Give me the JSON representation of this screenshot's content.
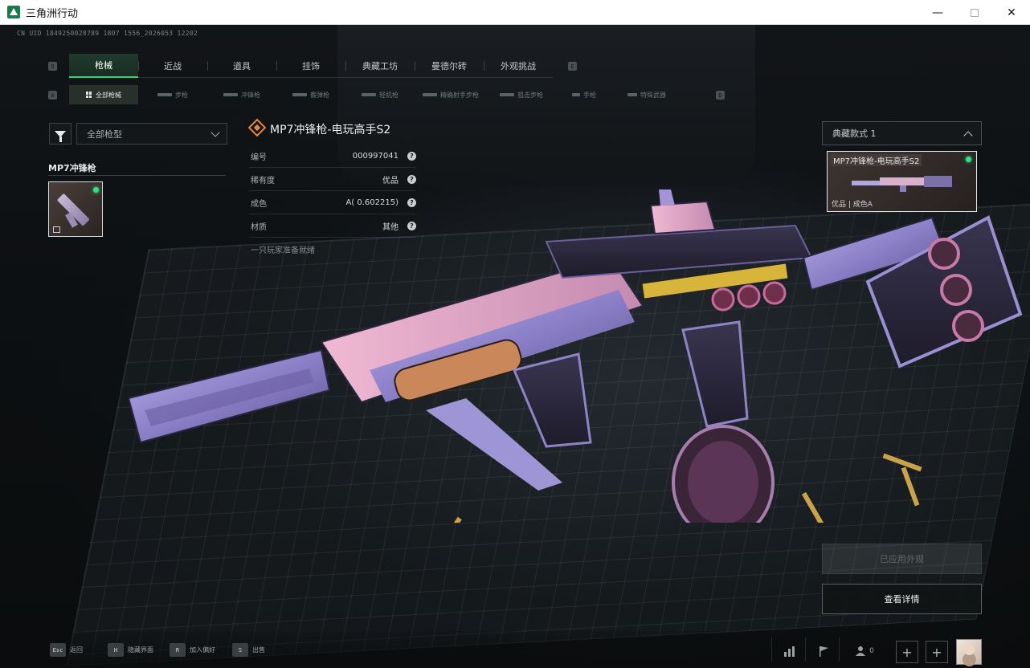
{
  "window": {
    "title": "三角洲行动"
  },
  "uid_text": "CN UID 1849250028789 1807 1556_2026053 12202",
  "key_hints": {
    "q": "Q",
    "e": "E",
    "a": "A",
    "d": "D"
  },
  "main_tabs": [
    {
      "label": "枪械",
      "active": true
    },
    {
      "label": "近战",
      "active": false
    },
    {
      "label": "道具",
      "active": false
    },
    {
      "label": "挂饰",
      "active": false
    },
    {
      "label": "典藏工坊",
      "active": false
    },
    {
      "label": "曼德尔砖",
      "active": false
    },
    {
      "label": "外观挑战",
      "active": false
    }
  ],
  "sub_tabs": [
    {
      "label": "全部枪械",
      "active": true
    },
    {
      "label": "步枪",
      "active": false
    },
    {
      "label": "冲锋枪",
      "active": false
    },
    {
      "label": "霰弹枪",
      "active": false
    },
    {
      "label": "轻机枪",
      "active": false
    },
    {
      "label": "精确射手步枪",
      "active": false
    },
    {
      "label": "狙击步枪",
      "active": false
    },
    {
      "label": "手枪",
      "active": false
    },
    {
      "label": "特殊武器",
      "active": false
    }
  ],
  "filter": {
    "dropdown_value": "全部枪型"
  },
  "weapon_group": {
    "title": "MP7冲锋枪"
  },
  "item": {
    "name": "MP7冲锋枪-电玩高手S2",
    "rows": [
      {
        "label": "编号",
        "value": "000997041"
      },
      {
        "label": "稀有度",
        "value": "优品"
      },
      {
        "label": "成色",
        "value": "A( 0.602215)"
      },
      {
        "label": "材质",
        "value": "其他"
      }
    ],
    "question_mark": "?",
    "note": "一只玩家准备就绪"
  },
  "variant": {
    "select_label": "典藏款式 1",
    "card_name": "MP7冲锋枪-电玩高手S2",
    "card_sub": "优品 | 成色A"
  },
  "buttons": {
    "applied": "已应用外观",
    "details": "查看详情"
  },
  "bottom_hints": [
    {
      "key": "Esc",
      "label": "返回"
    },
    {
      "key": "H",
      "label": "隐藏界面"
    },
    {
      "key": "R",
      "label": "加入偏好"
    },
    {
      "key": "S",
      "label": "出售"
    }
  ],
  "friends_count": "0",
  "colors": {
    "accent_green": "#37d07a",
    "rarity_orange": "#e2883f",
    "skin_purple": "#9b8fd0",
    "skin_pink": "#e6a9c8"
  },
  "icons": [
    "filter-icon",
    "chevron-down-icon",
    "chevron-up-icon",
    "stats-icon",
    "flag-icon",
    "friends-icon",
    "plus-icon"
  ]
}
